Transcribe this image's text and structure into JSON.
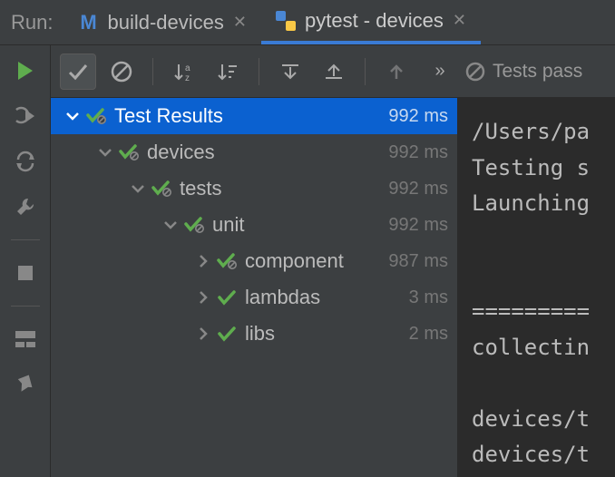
{
  "header": {
    "run_label": "Run:",
    "tabs": [
      {
        "label": "build-devices",
        "icon": "m",
        "active": false
      },
      {
        "label": "pytest - devices",
        "icon": "python",
        "active": true
      }
    ]
  },
  "toolbar": {
    "tests_summary": "Tests pass"
  },
  "tree": [
    {
      "depth": 0,
      "arrow": "down",
      "status": "pass-skip",
      "name": "Test Results",
      "time": "992 ms",
      "selected": true
    },
    {
      "depth": 1,
      "arrow": "down",
      "status": "pass-skip",
      "name": "devices",
      "time": "992 ms",
      "selected": false
    },
    {
      "depth": 2,
      "arrow": "down",
      "status": "pass-skip",
      "name": "tests",
      "time": "992 ms",
      "selected": false
    },
    {
      "depth": 3,
      "arrow": "down",
      "status": "pass-skip",
      "name": "unit",
      "time": "992 ms",
      "selected": false
    },
    {
      "depth": 4,
      "arrow": "right",
      "status": "pass-skip",
      "name": "component",
      "time": "987 ms",
      "selected": false
    },
    {
      "depth": 4,
      "arrow": "right",
      "status": "pass",
      "name": "lambdas",
      "time": "3 ms",
      "selected": false
    },
    {
      "depth": 4,
      "arrow": "right",
      "status": "pass",
      "name": "libs",
      "time": "2 ms",
      "selected": false
    }
  ],
  "console": {
    "lines": [
      "/Users/pa",
      "Testing s",
      "Launching",
      "",
      "",
      "=========",
      "collectin",
      "",
      "devices/t",
      "devices/t"
    ]
  }
}
